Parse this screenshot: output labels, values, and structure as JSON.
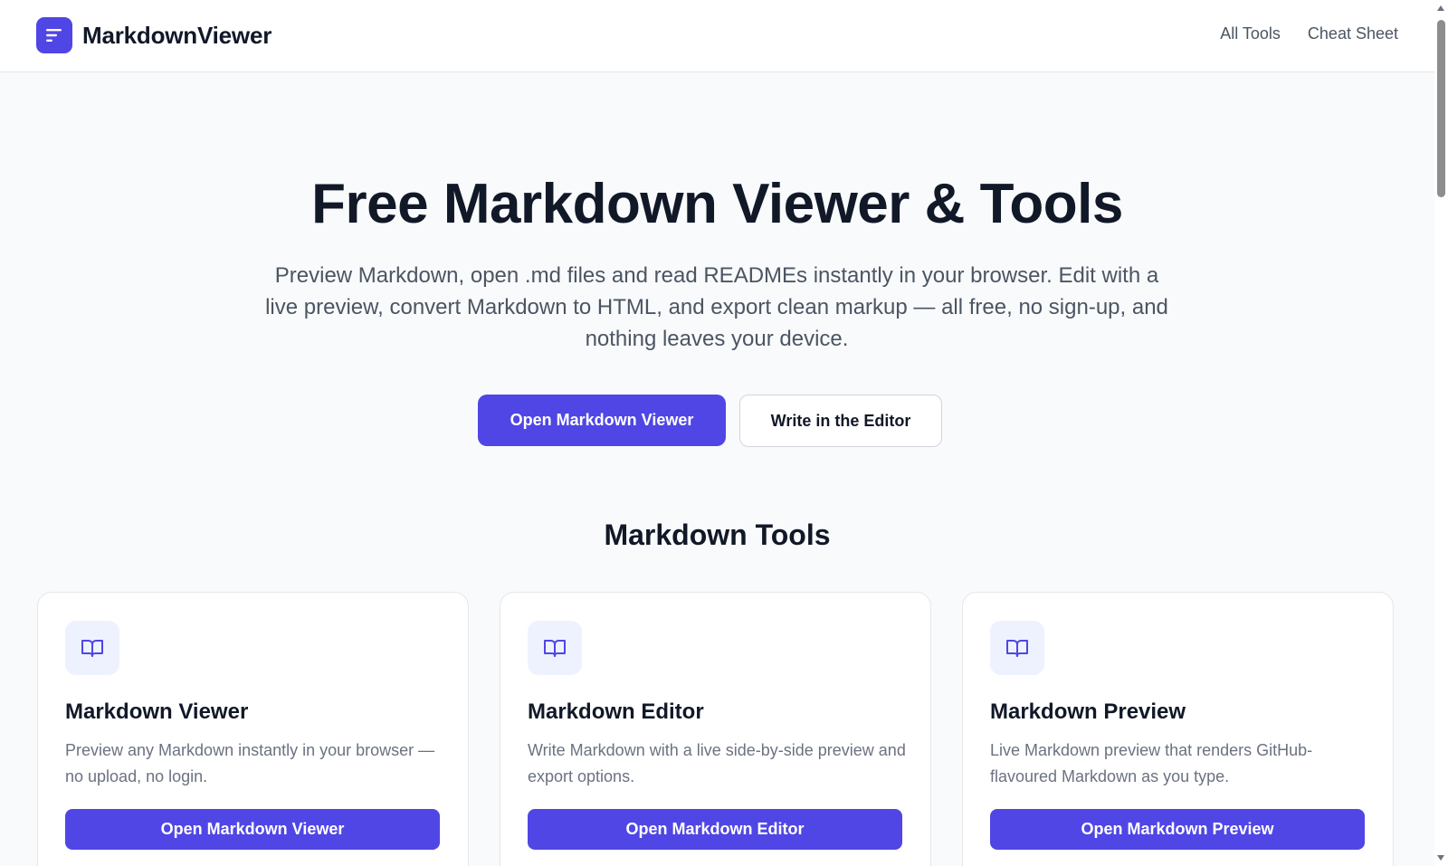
{
  "header": {
    "brand": "MarkdownViewer",
    "nav": [
      "All Tools",
      "Cheat Sheet"
    ]
  },
  "hero": {
    "title": "Free Markdown Viewer & Tools",
    "subtitle": "Preview Markdown, open .md files and read READMEs instantly in your browser. Edit with a live preview, convert Markdown to HTML, and export clean markup — all free, no sign-up, and nothing leaves your device.",
    "primary_button": "Open Markdown Viewer",
    "secondary_button": "Write in the Editor"
  },
  "tools": {
    "section_title": "Markdown Tools",
    "cards": [
      {
        "icon": "book-icon",
        "title": "Markdown Viewer",
        "description": "Preview any Markdown instantly in your browser — no upload, no login.",
        "button": "Open Markdown Viewer"
      },
      {
        "icon": "book-icon",
        "title": "Markdown Editor",
        "description": "Write Markdown with a live side-by-side preview and export options.",
        "button": "Open Markdown Editor"
      },
      {
        "icon": "book-icon",
        "title": "Markdown Preview",
        "description": "Live Markdown preview that renders GitHub-flavoured Markdown as you type.",
        "button": "Open Markdown Preview"
      }
    ]
  },
  "colors": {
    "accent": "#4f46e5",
    "icon_bg": "#eef2ff",
    "page_bg": "#f9fafb"
  }
}
